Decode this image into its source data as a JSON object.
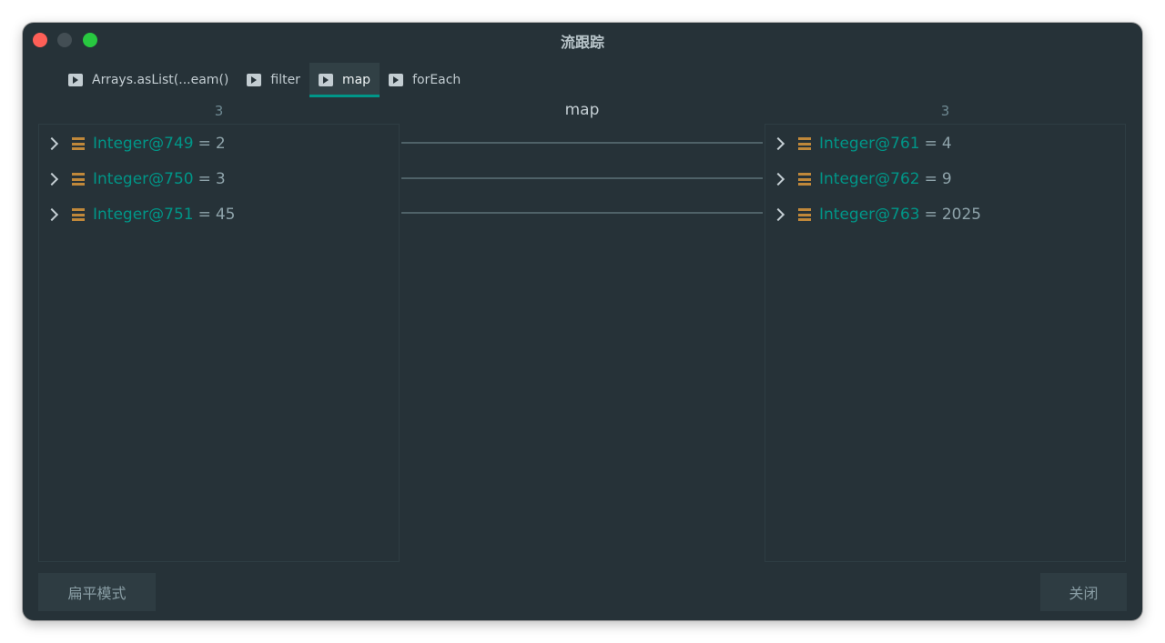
{
  "window": {
    "title": "流跟踪"
  },
  "tabs": [
    {
      "label": "Arrays.asList(...eam()",
      "active": false
    },
    {
      "label": "filter",
      "active": false
    },
    {
      "label": "map",
      "active": true
    },
    {
      "label": "forEach",
      "active": false
    }
  ],
  "columns": {
    "left_count": "3",
    "middle_label": "map",
    "right_count": "3"
  },
  "left_items": [
    {
      "name": "Integer@749",
      "eq": "=",
      "value": "2"
    },
    {
      "name": "Integer@750",
      "eq": "=",
      "value": "3"
    },
    {
      "name": "Integer@751",
      "eq": "=",
      "value": "45"
    }
  ],
  "right_items": [
    {
      "name": "Integer@761",
      "eq": "=",
      "value": "4"
    },
    {
      "name": "Integer@762",
      "eq": "=",
      "value": "9"
    },
    {
      "name": "Integer@763",
      "eq": "=",
      "value": "2025"
    }
  ],
  "buttons": {
    "flat_mode": "扁平模式",
    "close": "关闭"
  },
  "icons": {
    "tab_icon": "console-run-icon",
    "field_icon": "field-stack-icon",
    "expand_icon": "chevron-right-icon"
  },
  "colors": {
    "accent": "#009688",
    "field_icon": "#c0883a",
    "connector": "#5d7279"
  }
}
